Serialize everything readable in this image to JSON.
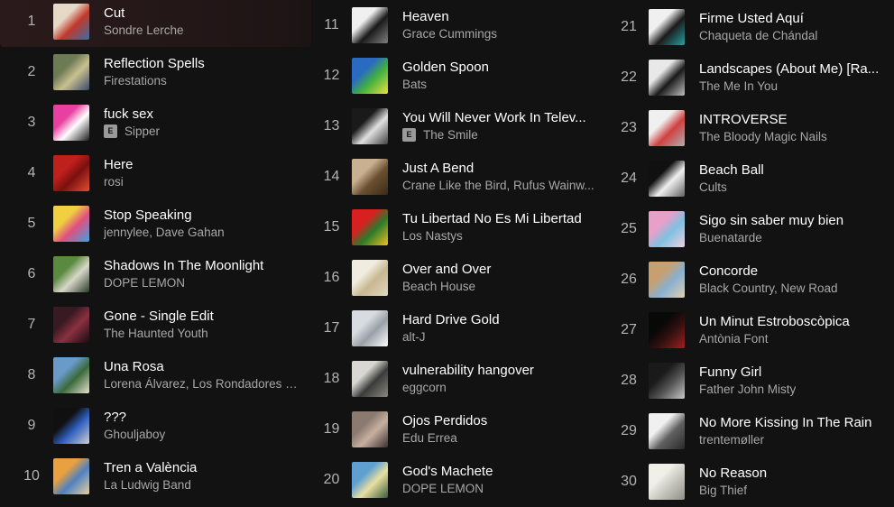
{
  "columns": [
    {
      "tracks": [
        {
          "num": "1",
          "title": "Cut",
          "artist": "Sondre Lerche",
          "explicit": false,
          "art": [
            "#e6d9c8",
            "#c0392b",
            "#3a6ea5"
          ]
        },
        {
          "num": "2",
          "title": "Reflection Spells",
          "artist": "Firestations",
          "explicit": false,
          "art": [
            "#6d7b55",
            "#c9c090",
            "#3a4a6a"
          ]
        },
        {
          "num": "3",
          "title": "fuck sex",
          "artist": "Sipper",
          "explicit": true,
          "art": [
            "#e83fa0",
            "#ffffff",
            "#1a1a1a"
          ]
        },
        {
          "num": "4",
          "title": "Here",
          "artist": "rosi",
          "explicit": false,
          "art": [
            "#c0201c",
            "#7a1010",
            "#e05030"
          ]
        },
        {
          "num": "5",
          "title": "Stop Speaking",
          "artist": "jennylee, Dave Gahan",
          "explicit": false,
          "art": [
            "#f0d040",
            "#e05080",
            "#40a0e0"
          ]
        },
        {
          "num": "6",
          "title": "Shadows In The Moonlight",
          "artist": "DOPE LEMON",
          "explicit": false,
          "art": [
            "#5a8a40",
            "#d8d8c8",
            "#2a3a2a"
          ]
        },
        {
          "num": "7",
          "title": "Gone - Single Edit",
          "artist": "The Haunted Youth",
          "explicit": false,
          "art": [
            "#3a1a22",
            "#8a3040",
            "#1a0a10"
          ]
        },
        {
          "num": "8",
          "title": "Una Rosa",
          "artist": "Lorena Álvarez, Los Rondadores de Sa...",
          "explicit": false,
          "art": [
            "#6a9ac8",
            "#3a6a3a",
            "#e8e0d0"
          ]
        },
        {
          "num": "9",
          "title": "???",
          "artist": "Ghouljaboy",
          "explicit": false,
          "art": [
            "#101010",
            "#3060c0",
            "#d0d0d0"
          ]
        },
        {
          "num": "10",
          "title": "Tren a València",
          "artist": "La Ludwig Band",
          "explicit": false,
          "art": [
            "#e8a040",
            "#5080c0",
            "#e8d0a0"
          ]
        }
      ]
    },
    {
      "tracks": [
        {
          "num": "11",
          "title": "Heaven",
          "artist": "Grace Cummings",
          "explicit": false,
          "art": [
            "#f0f0f0",
            "#1a1a1a",
            "#808080"
          ]
        },
        {
          "num": "12",
          "title": "Golden Spoon",
          "artist": "Bats",
          "explicit": false,
          "art": [
            "#2a6ac0",
            "#40b040",
            "#f0e040"
          ]
        },
        {
          "num": "13",
          "title": "You Will Never Work In Telev...",
          "artist": "The Smile",
          "explicit": true,
          "art": [
            "#1a1a1a",
            "#e0e0e0",
            "#404040"
          ]
        },
        {
          "num": "14",
          "title": "Just A Bend",
          "artist": "Crane Like the Bird, Rufus Wainw...",
          "explicit": false,
          "art": [
            "#c8b090",
            "#6a5030",
            "#3a2a1a"
          ]
        },
        {
          "num": "15",
          "title": "Tu Libertad No Es Mi Libertad",
          "artist": "Los Nastys",
          "explicit": false,
          "art": [
            "#d82020",
            "#2a7a2a",
            "#f0c020"
          ]
        },
        {
          "num": "16",
          "title": "Over and Over",
          "artist": "Beach House",
          "explicit": false,
          "art": [
            "#f0ece0",
            "#c8b890",
            "#e0d8c0"
          ]
        },
        {
          "num": "17",
          "title": "Hard Drive Gold",
          "artist": "alt-J",
          "explicit": false,
          "art": [
            "#d8dce0",
            "#9aa0a8",
            "#ffffff"
          ]
        },
        {
          "num": "18",
          "title": "vulnerability hangover",
          "artist": "eggcorn",
          "explicit": false,
          "art": [
            "#d8d8d0",
            "#3a3a3a",
            "#8a8a80"
          ]
        },
        {
          "num": "19",
          "title": "Ojos Perdidos",
          "artist": "Edu Errea",
          "explicit": false,
          "art": [
            "#8a7a70",
            "#c8b0a0",
            "#3a3030"
          ]
        },
        {
          "num": "20",
          "title": "God's Machete",
          "artist": "DOPE LEMON",
          "explicit": false,
          "art": [
            "#60a0d0",
            "#e8e0a0",
            "#3a5a3a"
          ]
        }
      ]
    },
    {
      "tracks": [
        {
          "num": "21",
          "title": "Firme Usted Aquí",
          "artist": "Chaqueta de Chándal",
          "explicit": false,
          "art": [
            "#f0f0f0",
            "#1a1a1a",
            "#2aa0a0"
          ]
        },
        {
          "num": "22",
          "title": "Landscapes (About Me) [Ra...",
          "artist": "The Me In You",
          "explicit": false,
          "art": [
            "#e8e8e8",
            "#1a1a1a",
            "#c0c0c0"
          ]
        },
        {
          "num": "23",
          "title": "INTROVERSE",
          "artist": "The Bloody Magic Nails",
          "explicit": false,
          "art": [
            "#f0f0f0",
            "#d04040",
            "#b0b0b0"
          ]
        },
        {
          "num": "24",
          "title": "Beach Ball",
          "artist": "Cults",
          "explicit": false,
          "art": [
            "#101010",
            "#f0f0f0",
            "#606060"
          ]
        },
        {
          "num": "25",
          "title": "Sigo sin saber muy bien",
          "artist": "Buenatarde",
          "explicit": false,
          "art": [
            "#e8a0c8",
            "#80c0e0",
            "#f0d0e0"
          ]
        },
        {
          "num": "26",
          "title": "Concorde",
          "artist": "Black Country, New Road",
          "explicit": false,
          "art": [
            "#c8a070",
            "#8ab0d0",
            "#e0d0b0"
          ]
        },
        {
          "num": "27",
          "title": "Un Minut Estroboscòpica",
          "artist": "Antònia Font",
          "explicit": false,
          "art": [
            "#080808",
            "#301010",
            "#a02020"
          ]
        },
        {
          "num": "28",
          "title": "Funny Girl",
          "artist": "Father John Misty",
          "explicit": false,
          "art": [
            "#1a1a1a",
            "#505050",
            "#c8c8c8"
          ]
        },
        {
          "num": "29",
          "title": "No More Kissing In The Rain",
          "artist": "trentemøller",
          "explicit": false,
          "art": [
            "#f0f0f0",
            "#606060",
            "#2a2a2a"
          ]
        },
        {
          "num": "30",
          "title": "No Reason",
          "artist": "Big Thief",
          "explicit": false,
          "art": [
            "#f0f0e8",
            "#c8c8c0",
            "#909088"
          ]
        }
      ]
    }
  ],
  "colors": {
    "background": "#121212",
    "title": "#ffffff",
    "artist": "#a7a7a7",
    "number": "#b3b3b3",
    "active_row": "#2a1a1b"
  },
  "explicit_badge": "E",
  "active_track": "1"
}
